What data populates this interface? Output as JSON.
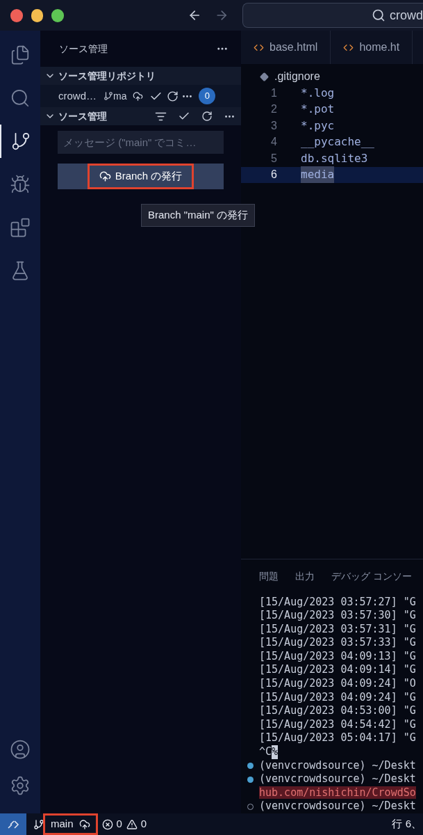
{
  "title_bar": {
    "search_text": "crowd"
  },
  "activity_bar": {
    "items": [
      {
        "kind": "files",
        "selected": false
      },
      {
        "kind": "search",
        "selected": false
      },
      {
        "kind": "scm",
        "selected": true
      },
      {
        "kind": "debug",
        "selected": false
      },
      {
        "kind": "extensions",
        "selected": false
      },
      {
        "kind": "testing",
        "selected": false
      }
    ],
    "bottom_items": [
      {
        "kind": "account"
      },
      {
        "kind": "settings"
      }
    ]
  },
  "sidebar": {
    "title": "ソース管理",
    "repositories": {
      "title": "ソース管理リポジトリ",
      "expanded": true,
      "repo": {
        "name": "crowd…",
        "branch": "ma",
        "badge": "0"
      }
    },
    "changes": {
      "title": "ソース管理",
      "expanded": true,
      "placeholder": "メッセージ (\"main\" でコミ…",
      "publish_button": {
        "label": "Branch の発行",
        "highlighted": true
      }
    },
    "tooltip": "Branch \"main\" の発行"
  },
  "editor": {
    "tabs": [
      {
        "label": "base.html",
        "selected": false
      },
      {
        "label": "home.ht",
        "selected": false
      }
    ],
    "breadcrumb": ".gitignore",
    "lines": [
      {
        "number": "1",
        "text": "*.log",
        "current": false
      },
      {
        "number": "2",
        "text": "*.pot",
        "current": false
      },
      {
        "number": "3",
        "text": "*.pyc",
        "current": false
      },
      {
        "number": "4",
        "text": "__pycache__",
        "current": false
      },
      {
        "number": "5",
        "text": "db.sqlite3",
        "current": false
      },
      {
        "number": "6",
        "text": "media",
        "current": true
      }
    ]
  },
  "panel": {
    "tabs": [
      {
        "label": "問題",
        "selected": false
      },
      {
        "label": "出力",
        "selected": false
      },
      {
        "label": "デバッグ コンソー",
        "selected": false
      }
    ],
    "terminal": [
      {
        "kind": "output",
        "text": "[15/Aug/2023 03:57:27] \"G"
      },
      {
        "kind": "output",
        "text": "[15/Aug/2023 03:57:30] \"G"
      },
      {
        "kind": "output",
        "text": "[15/Aug/2023 03:57:31] \"G"
      },
      {
        "kind": "output",
        "text": "[15/Aug/2023 03:57:33] \"G"
      },
      {
        "kind": "output",
        "text": "[15/Aug/2023 04:09:13] \"G"
      },
      {
        "kind": "output",
        "text": "[15/Aug/2023 04:09:14] \"G"
      },
      {
        "kind": "output",
        "text": "[15/Aug/2023 04:09:24] \"O"
      },
      {
        "kind": "output",
        "text": "[15/Aug/2023 04:09:24] \"G"
      },
      {
        "kind": "output",
        "text": "[15/Aug/2023 04:53:00] \"G"
      },
      {
        "kind": "output",
        "text": "[15/Aug/2023 04:54:42] \"G"
      },
      {
        "kind": "output",
        "text": "[15/Aug/2023 05:04:17] \"G"
      },
      {
        "kind": "interrupt",
        "text": "^C",
        "cursor": "%"
      },
      {
        "kind": "prompt",
        "text": "(venvcrowdsource) ~/Deskt",
        "finished": true
      },
      {
        "kind": "prompt",
        "text": "(venvcrowdsource) ~/Deskt",
        "finished": true
      },
      {
        "kind": "error",
        "text": "hub.com/nishichin/CrowdSo"
      },
      {
        "kind": "prompt",
        "text": "(venvcrowdsource) ~/Deskt",
        "finished": false
      }
    ]
  },
  "status_bar": {
    "branch": "main",
    "branch_highlighted": true,
    "errors": "0",
    "warnings": "0",
    "position": "行 6、"
  }
}
